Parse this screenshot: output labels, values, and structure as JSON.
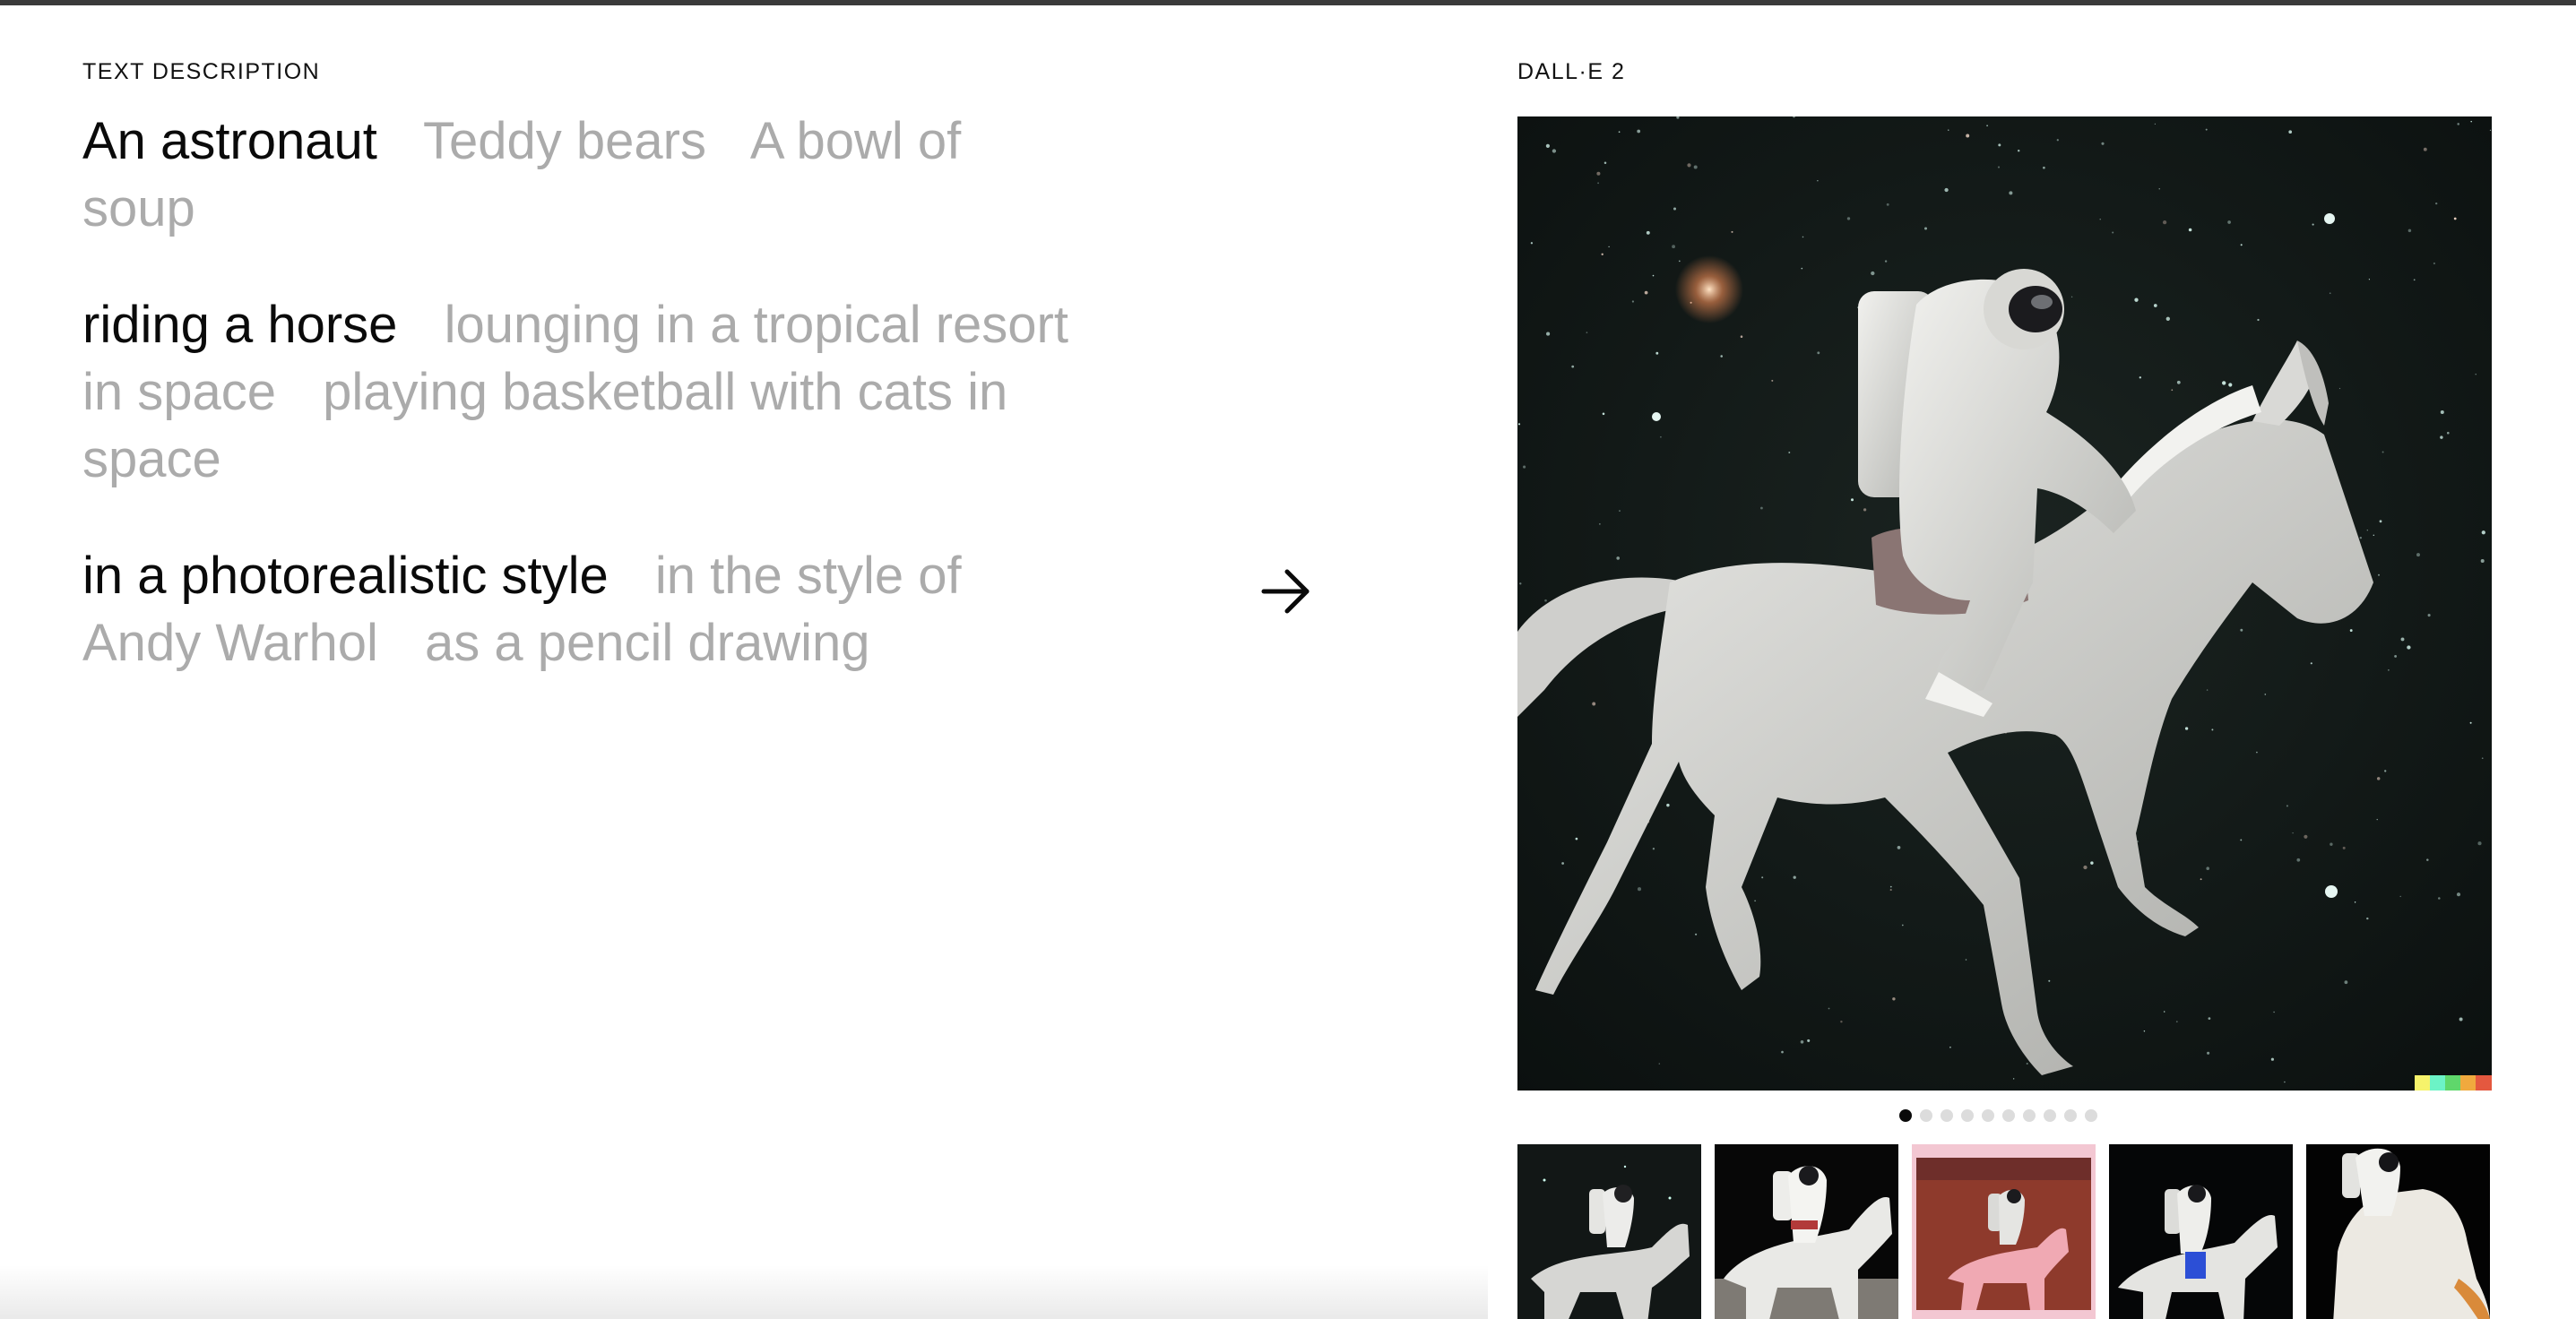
{
  "labels": {
    "text_description": "TEXT DESCRIPTION",
    "model": "DALL·E 2"
  },
  "prompt_groups": [
    {
      "options": [
        "An astronaut",
        "Teddy bears",
        "A bowl of soup"
      ],
      "selected": 0
    },
    {
      "options": [
        "riding a horse",
        "lounging in a tropical resort in space",
        "playing basketball with cats in space"
      ],
      "selected": 0
    },
    {
      "options": [
        "in a photorealistic style",
        "in the style of Andy Warhol",
        "as a pencil drawing"
      ],
      "selected": 0
    }
  ],
  "icons": {
    "generate": "arrow-right-icon"
  },
  "carousel": {
    "total": 10,
    "active": 0
  },
  "thumbnails": [
    "astronaut riding white horse in space",
    "astronaut on white horse on lunar surface",
    "astronaut on white horse on red desert",
    "astronaut on white horse in dark space",
    "astronaut on white horse with orange tail"
  ],
  "colors": {
    "active_text": "#0a0a0a",
    "inactive_text": "#ababab",
    "signature": [
      "#f6f36b",
      "#6cf3c6",
      "#5fd76b",
      "#f0a93e",
      "#e4583f",
      "#3d6ef2"
    ]
  }
}
